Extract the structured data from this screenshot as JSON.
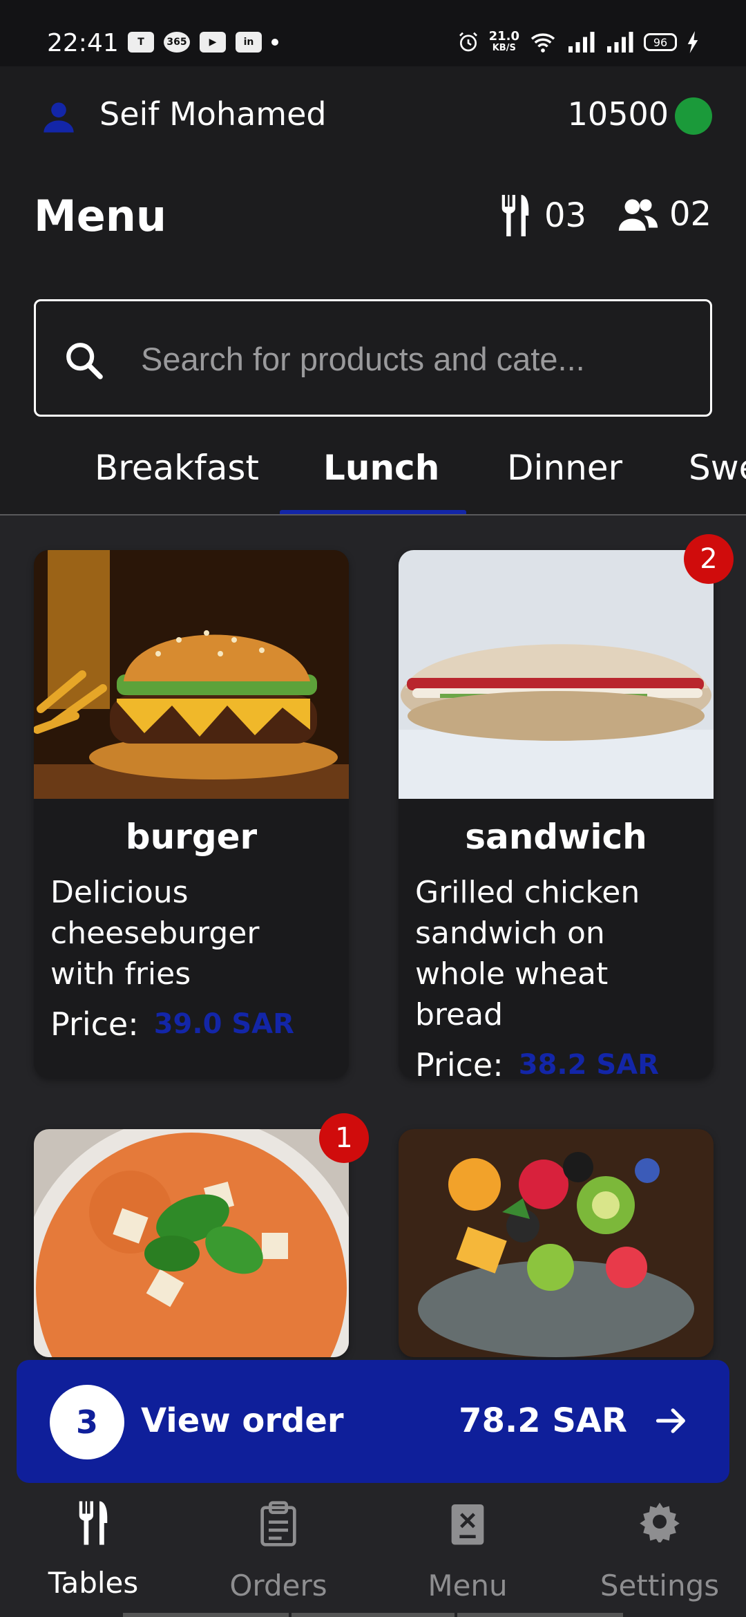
{
  "status_bar": {
    "time": "22:41",
    "apps": [
      "T",
      "365",
      "▶",
      "in"
    ],
    "net_speed_value": "21.0",
    "net_speed_unit": "KB/S",
    "battery": "96"
  },
  "header": {
    "user_name": "Seif Mohamed",
    "balance": "10500",
    "status_color": "#1b9a3a"
  },
  "menu": {
    "title": "Menu",
    "tables_count": "03",
    "guests_count": "02"
  },
  "search": {
    "placeholder": "Search for products and cate..."
  },
  "tabs": [
    {
      "label": "Breakfast"
    },
    {
      "label": "Lunch"
    },
    {
      "label": "Dinner"
    },
    {
      "label": "Swe"
    }
  ],
  "products": [
    {
      "name": "burger",
      "description": "Delicious cheeseburger with fries",
      "price_label": "Price:",
      "price": "39.0 SAR",
      "badge": ""
    },
    {
      "name": "sandwich",
      "description": "Grilled chicken sandwich on whole wheat bread",
      "price_label": "Price:",
      "price": "38.2 SAR",
      "badge": "2"
    },
    {
      "name": "",
      "description": "",
      "price_label": "",
      "price": "",
      "badge": "1"
    },
    {
      "name": "",
      "description": "",
      "price_label": "",
      "price": "",
      "badge": ""
    }
  ],
  "order": {
    "count": "3",
    "label": "View order",
    "total": "78.2 SAR"
  },
  "nav": [
    {
      "label": "Tables"
    },
    {
      "label": "Orders"
    },
    {
      "label": "Menu"
    },
    {
      "label": "Settings"
    }
  ],
  "colors": {
    "accent": "#1326a8",
    "order_bar": "#0f1f9a",
    "badge": "#d00c0c"
  }
}
